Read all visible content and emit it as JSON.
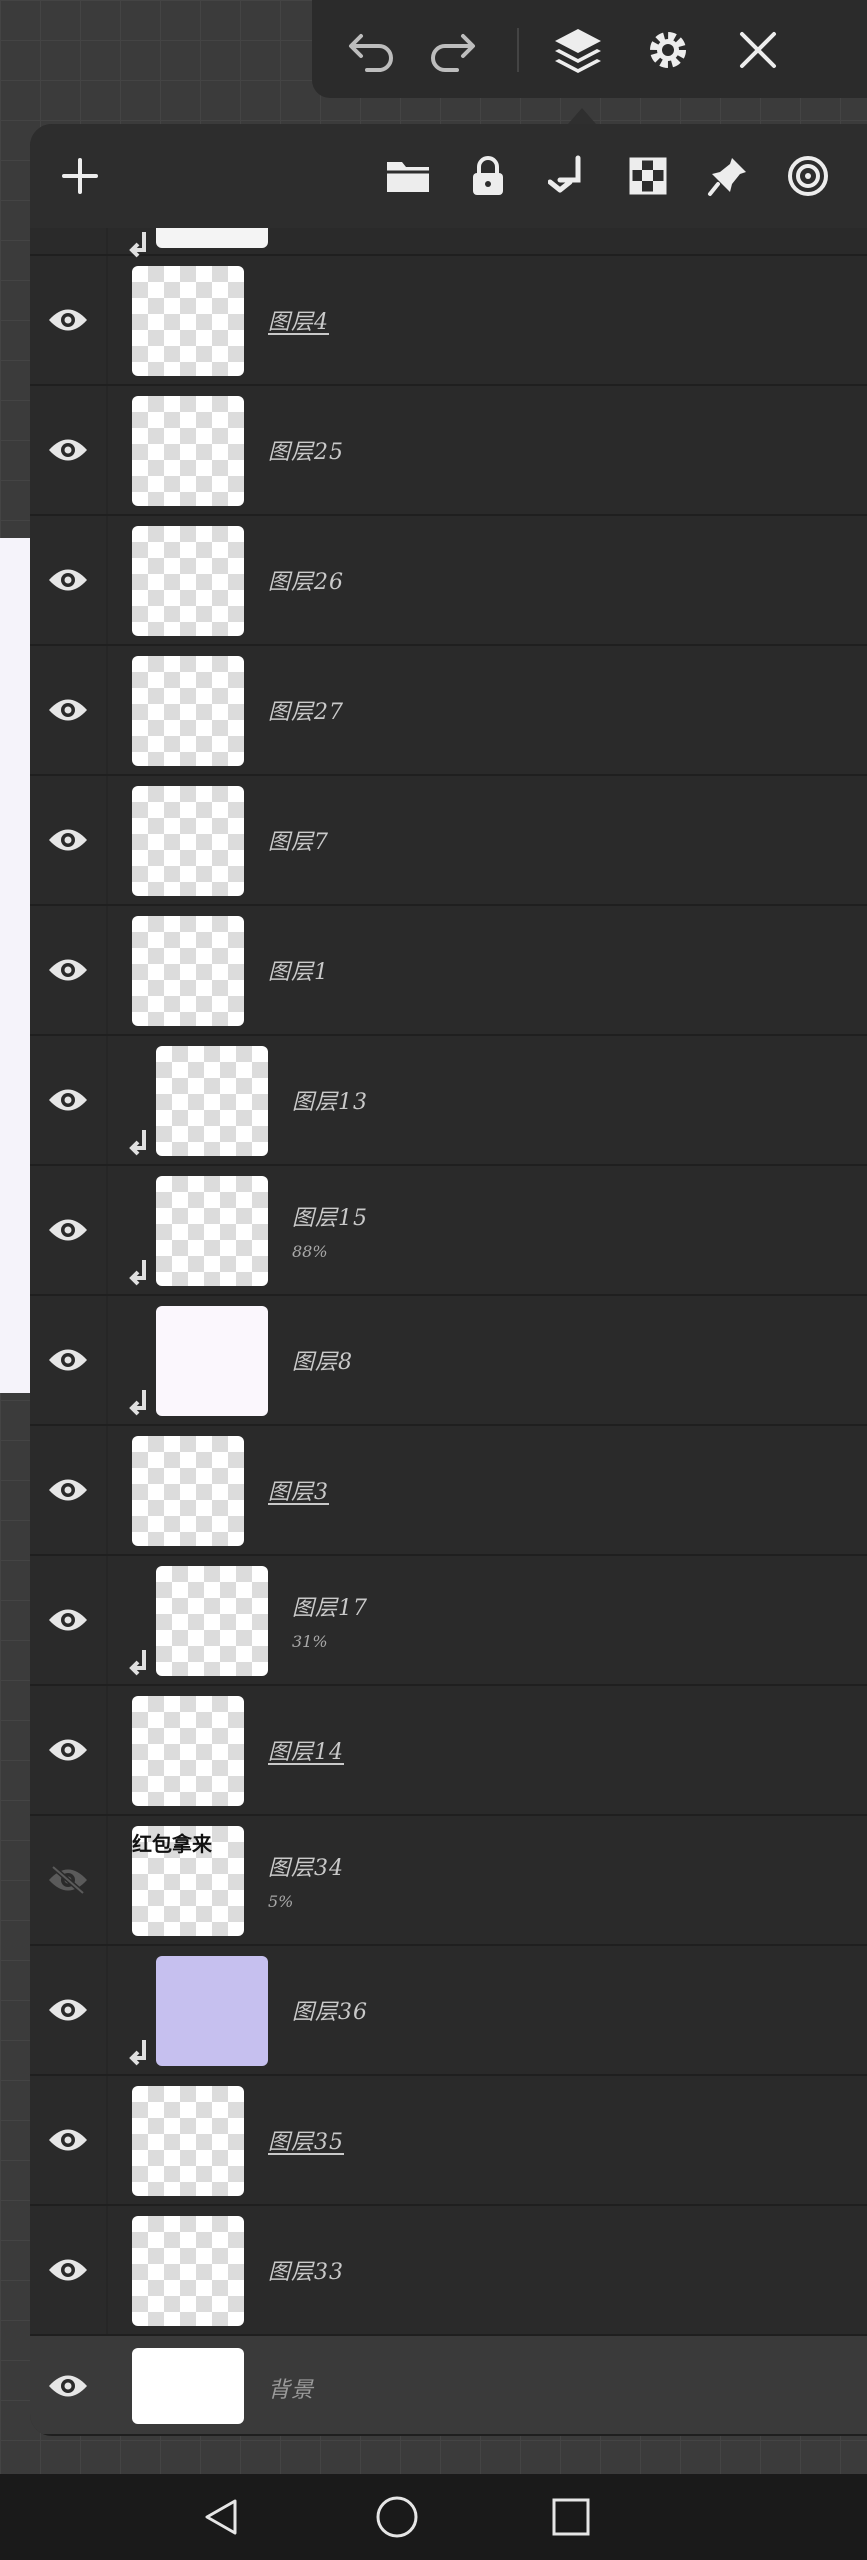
{
  "toolbar": {
    "icons": [
      "undo-icon",
      "redo-icon",
      "layers-icon",
      "settings-icon",
      "close-icon"
    ]
  },
  "layers_panel": {
    "header_icons": [
      "add-layer-icon",
      "folder-icon",
      "lock-icon",
      "clip-down-icon",
      "transparency-icon",
      "pin-icon",
      "target-icon"
    ],
    "layers": [
      {
        "name": "图层4",
        "visible": true,
        "clipped": false,
        "underline": true,
        "thumb": "checker"
      },
      {
        "name": "图层25",
        "visible": true,
        "clipped": false,
        "underline": false,
        "thumb": "checker"
      },
      {
        "name": "图层26",
        "visible": true,
        "clipped": false,
        "underline": false,
        "thumb": "checker"
      },
      {
        "name": "图层27",
        "visible": true,
        "clipped": false,
        "underline": false,
        "thumb": "checker"
      },
      {
        "name": "图层7",
        "visible": true,
        "clipped": false,
        "underline": false,
        "thumb": "checker"
      },
      {
        "name": "图层1",
        "visible": true,
        "clipped": false,
        "underline": false,
        "thumb": "checker"
      },
      {
        "name": "图层13",
        "visible": true,
        "clipped": true,
        "underline": false,
        "thumb": "checker"
      },
      {
        "name": "图层15",
        "opacity": "88%",
        "visible": true,
        "clipped": true,
        "underline": false,
        "thumb": "checker"
      },
      {
        "name": "图层8",
        "visible": true,
        "clipped": true,
        "underline": false,
        "thumb": "paper"
      },
      {
        "name": "图层3",
        "visible": true,
        "clipped": false,
        "underline": true,
        "thumb": "checker"
      },
      {
        "name": "图层17",
        "opacity": "31%",
        "visible": true,
        "clipped": true,
        "underline": false,
        "thumb": "checker"
      },
      {
        "name": "图层14",
        "visible": true,
        "clipped": false,
        "underline": true,
        "thumb": "checker"
      },
      {
        "name": "图层34",
        "opacity": "5%",
        "visible": false,
        "clipped": false,
        "underline": false,
        "thumb": "checker",
        "thumb_text": "红包拿来"
      },
      {
        "name": "图层36",
        "visible": true,
        "clipped": true,
        "underline": false,
        "thumb": "lavender"
      },
      {
        "name": "图层35",
        "visible": true,
        "clipped": false,
        "underline": true,
        "thumb": "checker"
      },
      {
        "name": "图层33",
        "visible": true,
        "clipped": false,
        "underline": false,
        "thumb": "checker"
      },
      {
        "name": "背景",
        "visible": true,
        "clipped": false,
        "underline": false,
        "thumb": "white",
        "selected": true
      }
    ]
  },
  "colors": {
    "panel_bg": "#2a2a2a",
    "selected_row": "#3a3a3a",
    "icon": "#e6e6e6",
    "hidden_icon": "#5a5a5a",
    "lavender": "#c6c0ef"
  },
  "nav_bar": {
    "icons": [
      "back-icon",
      "home-icon",
      "recents-icon"
    ]
  }
}
